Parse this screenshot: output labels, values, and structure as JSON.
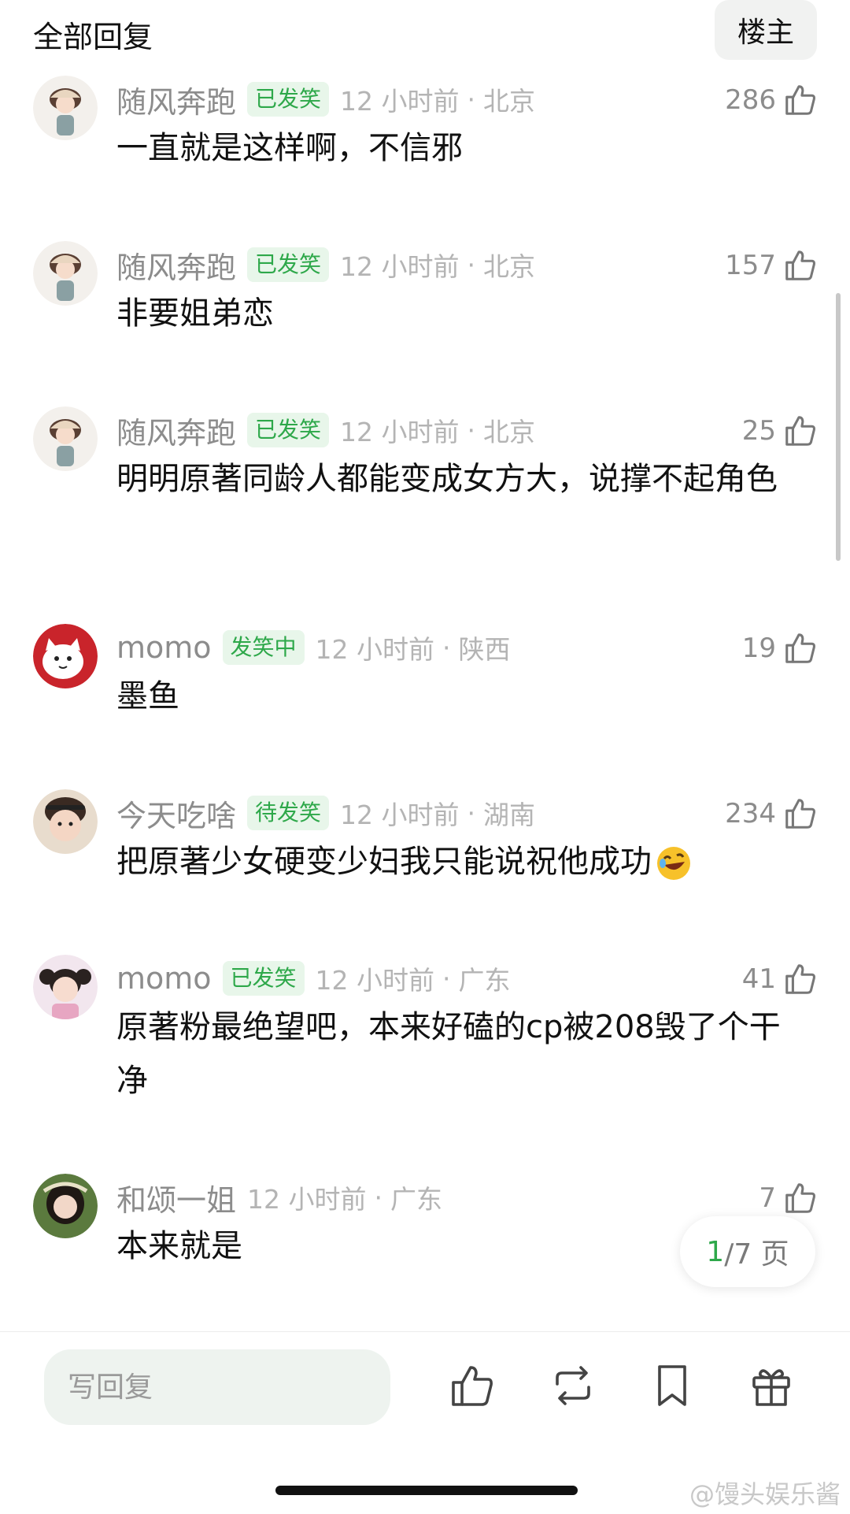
{
  "header": {
    "title": "全部回复",
    "op_filter_label": "楼主"
  },
  "comments": [
    {
      "username": "随风奔跑",
      "badge": "已发笑",
      "time": "12 小时前",
      "location": "北京",
      "likes": "286",
      "text": "一直就是这样啊，不信邪",
      "avatar": "girl-cartoon-avatar"
    },
    {
      "username": "随风奔跑",
      "badge": "已发笑",
      "time": "12 小时前",
      "location": "北京",
      "likes": "157",
      "text": "非要姐弟恋",
      "avatar": "girl-cartoon-avatar"
    },
    {
      "username": "随风奔跑",
      "badge": "已发笑",
      "time": "12 小时前",
      "location": "北京",
      "likes": "25",
      "text": "明明原著同龄人都能变成女方大，说撑不起角色",
      "avatar": "girl-cartoon-avatar"
    },
    {
      "username": "momo",
      "badge": "发笑中",
      "time": "12 小时前",
      "location": "陕西",
      "likes": "19",
      "text": "墨鱼",
      "avatar": "cat-avatar"
    },
    {
      "username": "今天吃啥",
      "badge": "待发笑",
      "time": "12 小时前",
      "location": "湖南",
      "likes": "234",
      "text": "把原著少女硬变少妇我只能说祝他成功",
      "emoji": "rolling-laughing-emoji",
      "avatar": "child-avatar"
    },
    {
      "username": "momo",
      "badge": "已发笑",
      "time": "12 小时前",
      "location": "广东",
      "likes": "41",
      "text": "原著粉最绝望吧，本来好磕的cp被208毁了个干净",
      "avatar": "girl-photo-avatar"
    },
    {
      "username": "和颂一姐",
      "badge": "",
      "time": "12 小时前",
      "location": "广东",
      "likes": "7",
      "text": "本来就是",
      "avatar": "woman-photo-avatar"
    }
  ],
  "pager": {
    "current": "1",
    "total": "/7 页"
  },
  "bottom_bar": {
    "reply_placeholder": "写回复"
  },
  "watermark": "@馒头娱乐酱",
  "colors": {
    "accent": "#2ea84a",
    "badge_bg": "#e8f6ea",
    "meta_gray": "#b4b4b4"
  }
}
